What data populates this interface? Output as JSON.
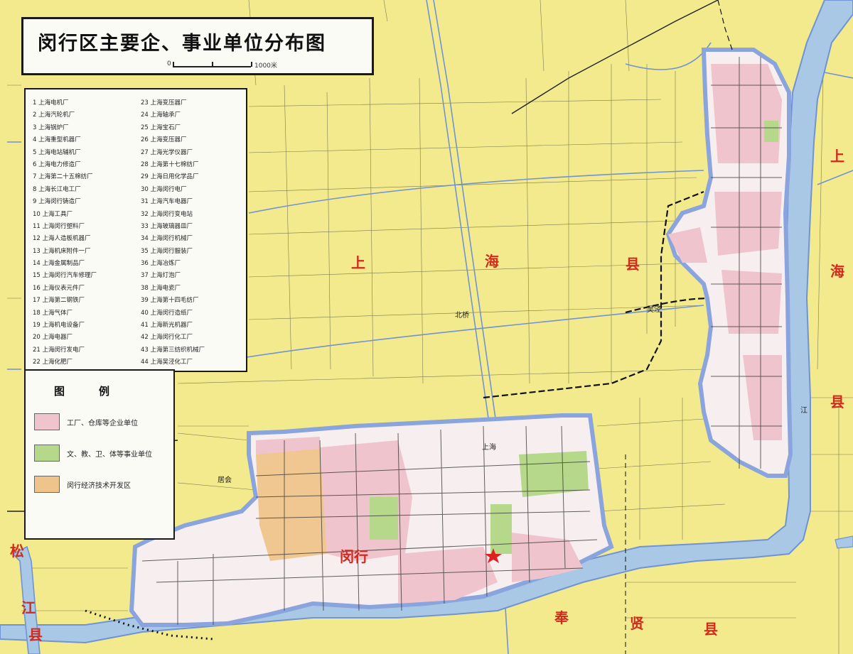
{
  "title": "闵行区主要企、事业单位分布图",
  "scale": {
    "left_label": "0",
    "right_label": "1000米"
  },
  "enterprise_list": [
    "1 上海电机厂",
    "2 上海汽轮机厂",
    "3 上海锅炉厂",
    "4 上海重型机器厂",
    "5 上海电站辅机厂",
    "6 上海电力修造厂",
    "7 上海第二十五棉纺厂",
    "8 上海长江电工厂",
    "9 上海闵行铸造厂",
    "10 上海工具厂",
    "11 上海闵行塑料厂",
    "12 上海人造板机器厂",
    "13 上海机床附件一厂",
    "14 上海金属制品厂",
    "15 上海闵行汽车修理厂",
    "16 上海仪表元件厂",
    "17 上海第二钢铁厂",
    "18 上海气体厂",
    "19 上海机电设备厂",
    "20 上海电器厂",
    "21 上海闵行发电厂",
    "22 上海化肥厂",
    "23 上海变压器厂",
    "24 上海轴承厂",
    "25 上海宝石厂",
    "26 上海变压器厂",
    "27 上海光学仪器厂",
    "28 上海第十七棉纺厂",
    "29 上海日用化学品厂",
    "30 上海闵行电厂",
    "31 上海汽车电器厂",
    "32 上海闵行变电站",
    "33 上海玻璃器皿厂",
    "34 上海闵行机械厂",
    "35 上海闵行服装厂",
    "36 上海冶炼厂",
    "37 上海灯泡厂",
    "38 上海电瓷厂",
    "39 上海第十四毛纺厂",
    "40 上海闵行造纸厂",
    "41 上海新光机器厂",
    "42 上海闵行化工厂",
    "43 上海第三纺织机械厂",
    "44 上海吴泾化工厂"
  ],
  "legend": {
    "title": "图例",
    "items": [
      {
        "label": "工厂、仓库等企业单位",
        "color": "#f0c4cc"
      },
      {
        "label": "文、教、卫、体等事业单位",
        "color": "#b6d88a"
      },
      {
        "label": "闵行经济技术开发区",
        "color": "#efc48a"
      }
    ]
  },
  "place_labels": {
    "county_left_top": "松",
    "county_left_mid": "江",
    "county_left_bot": "县",
    "shanghai_shang": "上",
    "shanghai_hai": "海",
    "shanghai_xian": "县",
    "right_shang": "上",
    "right_hai": "海",
    "right_xian": "县",
    "fengxian_feng": "奉",
    "fengxian_xian1": "贤",
    "fengxian_xian2": "县",
    "mh_big": "闵行",
    "beiqiao": "北桥",
    "shanghai_rail": "上海",
    "wujing": "吴泾",
    "lijiang": "江",
    "town_center": "居会"
  },
  "colors": {
    "background": "#f2ea8c",
    "water": "#a8c8e6",
    "river_edge": "#6f93d4",
    "enterprise": "#f0c4cc",
    "institution": "#b6d88a",
    "devzone": "#efc48a",
    "label_red": "#d22a1c"
  },
  "icons": {
    "star": "red-star-icon"
  }
}
